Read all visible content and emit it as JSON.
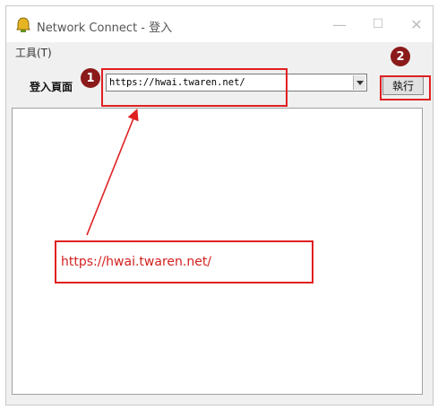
{
  "window": {
    "title": "Network Connect - 登入",
    "controls": {
      "minimize": "—",
      "maximize": "☐",
      "close": "✕"
    }
  },
  "menu": {
    "tools": "工具(T)"
  },
  "form": {
    "url_label": "登入頁面",
    "url_value": "https://hwai.twaren.net/",
    "execute_label": "執行"
  },
  "annotations": {
    "badge1": "1",
    "badge2": "2",
    "callout_text": "https://hwai.twaren.net/",
    "color": "#e02020",
    "badge_color": "#8b1a1a"
  }
}
